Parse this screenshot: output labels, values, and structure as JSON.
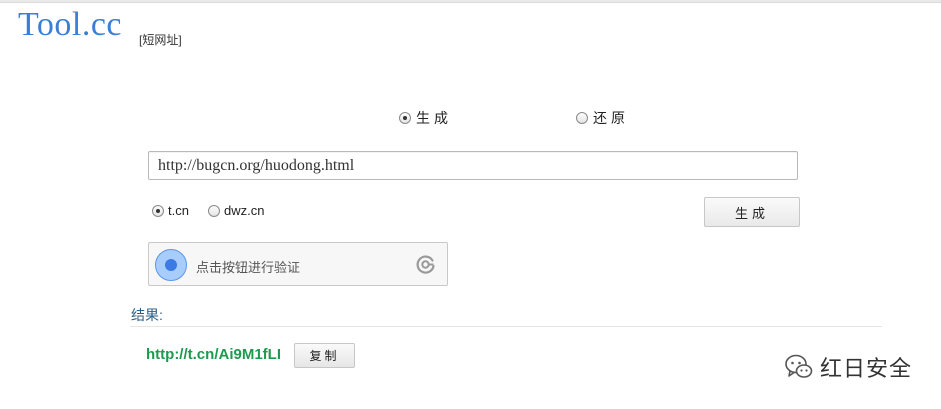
{
  "header": {
    "logo": "Tool.cc",
    "subtitle": "[短网址]"
  },
  "mode": {
    "generate_label": "生成",
    "restore_label": "还原",
    "selected": "generate"
  },
  "url_input": {
    "value": "http://bugcn.org/huodong.html"
  },
  "service": {
    "options": [
      "t.cn",
      "dwz.cn"
    ],
    "selected": "t.cn"
  },
  "generate_button": {
    "label": "生成"
  },
  "captcha": {
    "text": "点击按钮进行验证"
  },
  "result": {
    "label": "结果:",
    "short_url": "http://t.cn/Ai9M1fLI",
    "copy_label": "复制"
  },
  "watermark": {
    "text": "红日安全"
  },
  "colors": {
    "logo": "#3a7fd5",
    "result_link": "#1e9a4e",
    "result_label": "#2b5f8a",
    "captcha_accent": "#3c7ae6"
  }
}
